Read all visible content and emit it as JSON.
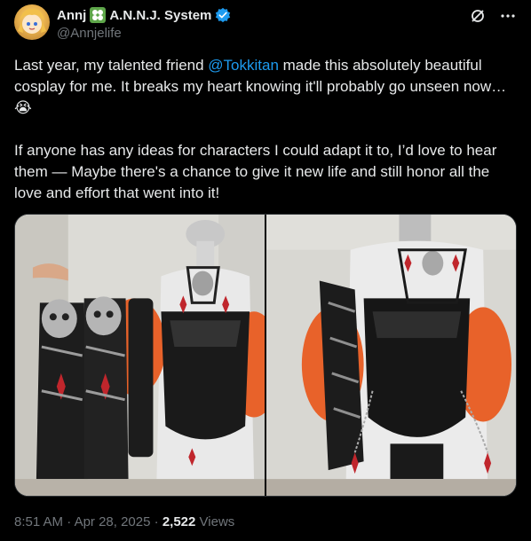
{
  "author": {
    "display_name": "Annj",
    "system_label": "A.N.N.J. System",
    "handle": "@Annjelife",
    "verified_icon": "verified-badge-icon",
    "avatar_icon": "avatar-anime-icon"
  },
  "tweet": {
    "text_part1": "Last year, my talented friend ",
    "mention": "@Tokkitan",
    "text_part2": " made this absolutely beautiful cosplay for me. It breaks my heart knowing it'll probably go unseen now… ",
    "emoji": "😭",
    "text_part3": "\n\nIf anyone has any ideas for characters I could adapt it to, I’d love to hear them — Maybe there's a chance to give it new life and still honor all the love and effort that went into it!"
  },
  "meta": {
    "time": "8:51 AM",
    "sep1": "·",
    "date": "Apr 28, 2025",
    "sep2": "·",
    "views_count": "2,522",
    "views_label": "Views"
  },
  "colors": {
    "background": "#000000",
    "text": "#e7e9ea",
    "muted": "#71767b",
    "accent": "#1d9bf0",
    "border": "#2f3336"
  }
}
